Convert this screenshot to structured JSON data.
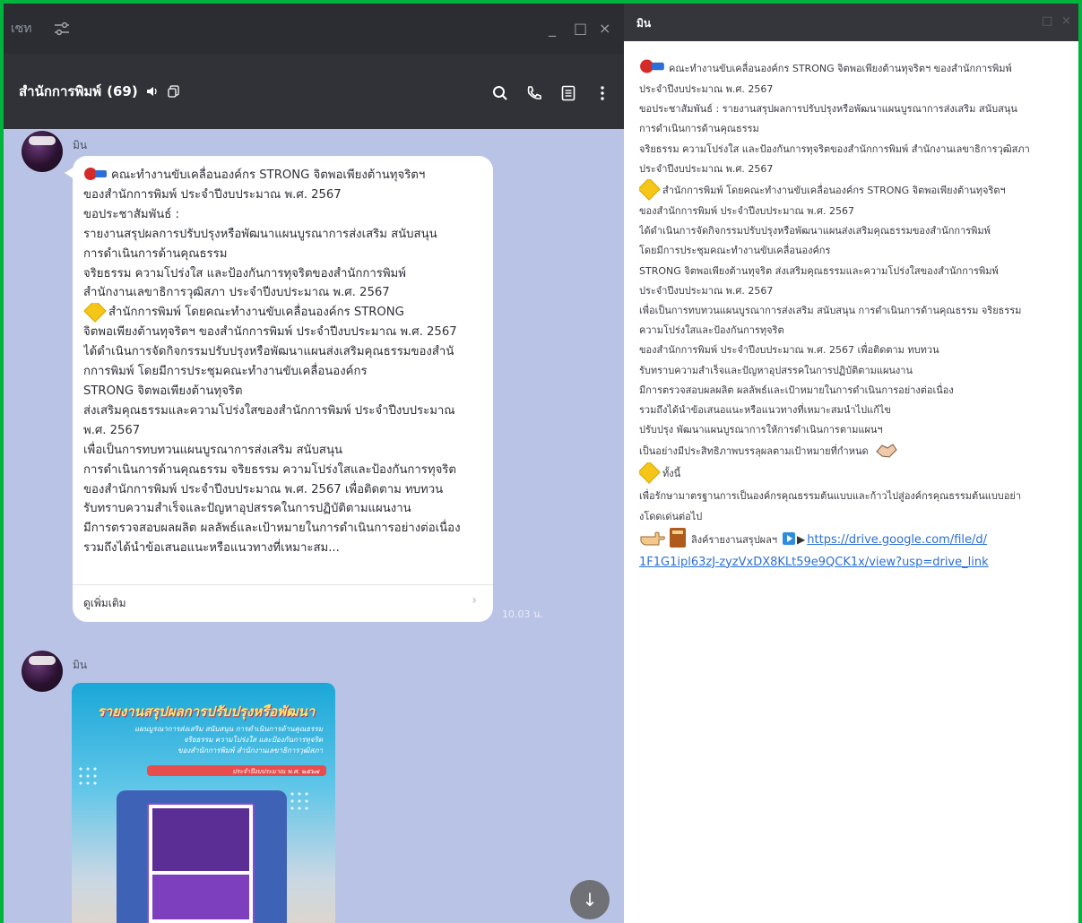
{
  "colors": {
    "frame_border": "#00b33c",
    "chat_bg": "#b9c3e6",
    "titlebar_bg": "#2b2d33",
    "header_bg": "#303237",
    "note_title_bg": "#34363c",
    "link": "#2b6fd6"
  },
  "left_window": {
    "app_label": "เซท",
    "window_controls": [
      "_",
      "□",
      "×"
    ],
    "room_title": "สำนักการพิมพ์",
    "room_count": "(69)",
    "header_icons": [
      "mute-icon",
      "copy-icon",
      "search-icon",
      "phone-icon",
      "notes-icon",
      "more-icon"
    ]
  },
  "message1": {
    "sender": "มิน",
    "lines": [
      "คณะทำงานขับเคลื่อนองค์กร STRONG จิตพอเพียงต้านทุจริตฯ",
      "ของสำนักการพิมพ์ ประจำปีงบประมาณ พ.ศ. 2567",
      "ขอประชาสัมพันธ์ :",
      "รายงานสรุปผลการปรับปรุงหรือพัฒนาแผนบูรณาการส่งเสริม สนับสนุน",
      "การดำเนินการด้านคุณธรรม",
      "จริยธรรม ความโปร่งใส และป้องกันการทุจริตของสำนักการพิมพ์",
      "สำนักงานเลขาธิการวุฒิสภา ประจำปีงบประมาณ พ.ศ. 2567",
      "สำนักการพิมพ์ โดยคณะทำงานขับเคลื่อนองค์กร STRONG",
      "จิตพอเพียงต้านทุจริตฯ ของสำนักการพิมพ์ ประจำปีงบประมาณ พ.ศ. 2567",
      "ได้ดำเนินการจัดกิจกรรมปรับปรุงหรือพัฒนาแผนส่งเสริมคุณธรรมของสำนั",
      "กการพิมพ์ โดยมีการประชุมคณะทำงานขับเคลื่อนองค์กร",
      "STRONG จิตพอเพียงต้านทุจริต",
      "ส่งเสริมคุณธรรมและความโปร่งใสของสำนักการพิมพ์ ประจำปีงบประมาณ",
      "พ.ศ. 2567",
      "เพื่อเป็นการทบทวนแผนบูรณาการส่งเสริม สนับสนุน",
      "การดำเนินการด้านคุณธรรม จริยธรรม ความโปร่งใสและป้องกันการทุจริต",
      "ของสำนักการพิมพ์ ประจำปีงบประมาณ พ.ศ. 2567 เพื่อติดตาม ทบทวน",
      "รับทราบความสำเร็จและปัญหาอุปสรรคในการปฏิบัติตามแผนงาน",
      "มีการตรวจสอบผลผลิต ผลลัพธ์และเป้าหมายในการดำเนินการอย่างต่อเนื่อง",
      "รวมถึงได้นำข้อเสนอแนะหรือแนวทางที่เหมาะสม..."
    ],
    "see_more": "ดูเพิ่มเติม",
    "see_more_arrow": "›",
    "time": "10.03 น."
  },
  "message2": {
    "sender": "มิน",
    "poster_title": "รายงานสรุปผลการปรับปรุงหรือพัฒนา",
    "poster_subtitle_lines": [
      "แผนบูรณาการส่งเสริม สนับสนุน การดำเนินการด้านคุณธรรม",
      "จริยธรรม ความโปร่งใส และป้องกันการทุจริต",
      "ของสำนักการพิมพ์ สำนักงานเลขาธิการวุฒิสภา"
    ],
    "poster_bar_text": "ประจำปีงบประมาณ พ.ศ. ๒๕๖๗"
  },
  "scroll_down_label": "↓",
  "note_window": {
    "title": "มิน",
    "controls": [
      "□",
      "×"
    ],
    "lines": [
      "คณะทำงานขับเคลื่อนองค์กร STRONG จิตพอเพียงต้านทุจริตฯ ของสำนักการพิมพ์",
      "ประจำปีงบประมาณ พ.ศ. 2567",
      "ขอประชาสัมพันธ์ : รายงานสรุปผลการปรับปรุงหรือพัฒนาแผนบูรณาการส่งเสริม สนับสนุน",
      "การดำเนินการด้านคุณธรรม",
      "จริยธรรม ความโปร่งใส และป้องกันการทุจริตของสำนักการพิมพ์ สำนักงานเลขาธิการวุฒิสภา",
      "ประจำปีงบประมาณ พ.ศ. 2567",
      "สำนักการพิมพ์ โดยคณะทำงานขับเคลื่อนองค์กร STRONG จิตพอเพียงต้านทุจริตฯ",
      "ของสำนักการพิมพ์ ประจำปีงบประมาณ พ.ศ. 2567",
      "ได้ดำเนินการจัดกิจกรรมปรับปรุงหรือพัฒนาแผนส่งเสริมคุณธรรมของสำนักการพิมพ์",
      "โดยมีการประชุมคณะทำงานขับเคลื่อนองค์กร",
      "STRONG จิตพอเพียงต้านทุจริต ส่งเสริมคุณธรรมและความโปร่งใสของสำนักการพิมพ์",
      "ประจำปีงบประมาณ พ.ศ. 2567",
      "เพื่อเป็นการทบทวนแผนบูรณาการส่งเสริม สนับสนุน การดำเนินการด้านคุณธรรม จริยธรรม",
      "ความโปร่งใสและป้องกันการทุจริต",
      "ของสำนักการพิมพ์ ประจำปีงบประมาณ พ.ศ. 2567 เพื่อติดตาม ทบทวน",
      "รับทราบความสำเร็จและปัญหาอุปสรรคในการปฏิบัติตามแผนงาน",
      "มีการตรวจสอบผลผลิต ผลลัพธ์และเป้าหมายในการดำเนินการอย่างต่อเนื่อง",
      "รวมถึงได้นำข้อเสนอแนะหรือแนวทางที่เหมาะสมนำไปแก้ไข",
      "ปรับปรุง พัฒนาแผนบูรณาการให้การดำเนินการตามแผนฯ",
      "เป็นอย่างมีประสิทธิภาพบรรลุผลตามเป้าหมายที่กำหนด",
      "ทั้งนี้",
      "เพื่อรักษามาตรฐานการเป็นองค์กรคุณธรรมต้นแบบและก้าวไปสู่องค์กรคุณธรรมต้นแบบอย่า",
      "งโดดเด่นต่อไป"
    ],
    "link_label": "ลิงค์รายงานสรุปผลฯ",
    "link_url_line1": "https://drive.google.com/file/d/",
    "link_url_line2": "1F1G1ipl63zJ-zyzVxDX8KLt59e9QCK1x/view?usp=drive_link"
  }
}
